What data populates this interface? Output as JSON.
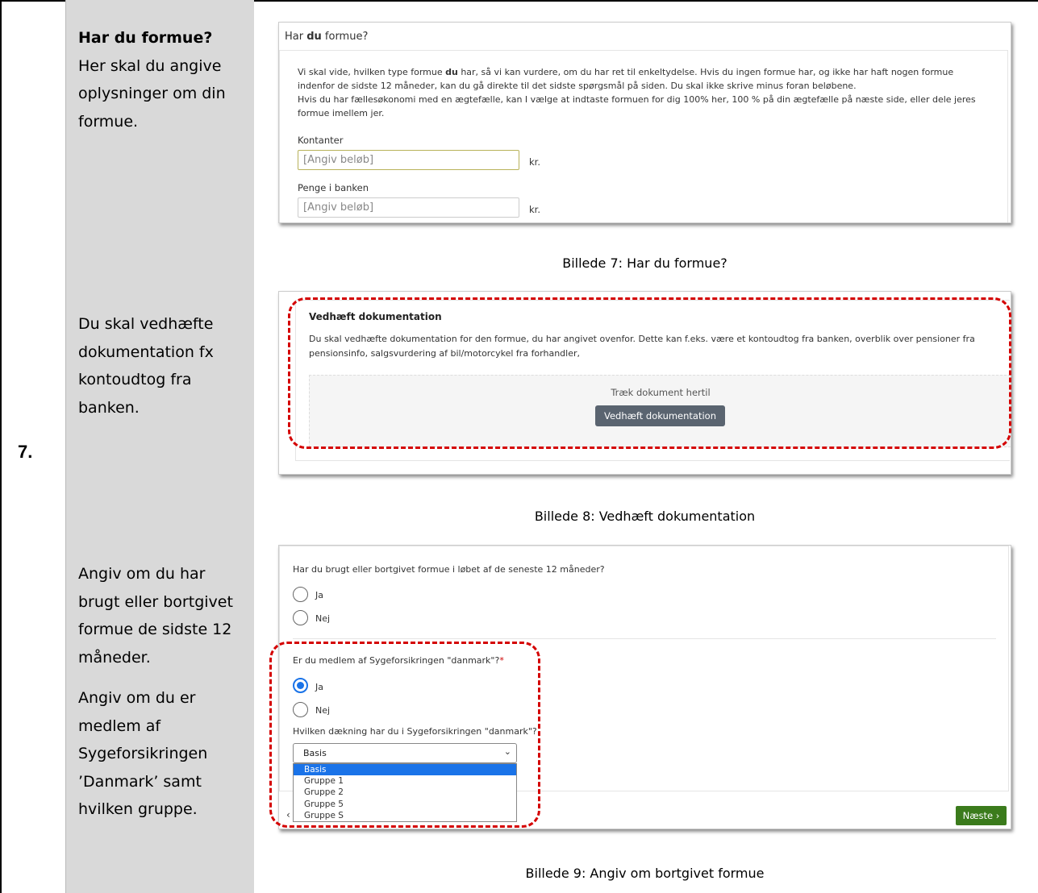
{
  "step": {
    "number": "7."
  },
  "instructions": {
    "one_title": "Har du formue?",
    "one_body": "Her skal du angive oplysninger om din formue.",
    "two_body": "Du skal vedhæfte dokumentation fx kontoudtog fra banken.",
    "three_body_a": "Angiv om du har brugt eller bortgivet formue de sidste 12 måneder.",
    "three_body_b": "Angiv om du er medlem af Sygeforsikringen ’Danmark’ samt hvilken gruppe."
  },
  "shot1": {
    "title_pre": "Har ",
    "title_bold": "du",
    "title_post": " formue?",
    "desc_a": "Vi skal vide, hvilken type formue ",
    "desc_bold": "du",
    "desc_b": " har, så vi kan vurdere, om du har ret til enkeltydelse. Hvis du ingen formue har, og ikke har haft nogen formue indenfor de sidste 12 måneder, kan du gå direkte til det sidste spørgsmål på siden. Du skal ikke skrive minus foran beløbene.",
    "desc_c": "Hvis du har fællesøkonomi med en ægtefælle,  kan I vælge at indtaste formuen for dig 100% her, 100 % på din ægtefælle på næste side, eller dele jeres formue imellem jer.",
    "field1_label": "Kontanter",
    "field1_placeholder": "[Angiv beløb]",
    "field2_label": "Penge i banken",
    "field2_placeholder": "[Angiv beløb]",
    "unit": "kr."
  },
  "caption1": "Billede 7: Har du formue?",
  "shot2": {
    "heading": "Vedhæft dokumentation",
    "desc": "Du skal vedhæfte dokumentation for den formue, du har angivet ovenfor. Dette kan f.eks. være et kontoudtog fra banken, overblik over pensioner fra pensionsinfo, salgsvurdering af bil/motorcykel fra forhandler,",
    "drop_text": "Træk dokument hertil",
    "attach_label": "Vedhæft dokumentation"
  },
  "caption2": "Billede 8: Vedhæft dokumentation",
  "shot3": {
    "q1": "Har du brugt eller bortgivet formue i løbet af de seneste 12 måneder?",
    "yes": "Ja",
    "no": "Nej",
    "q2": "Er du medlem af Sygeforsikringen \"danmark\"?",
    "required_mark": "*",
    "q3": "Hvilken dækning har du i Sygeforsikringen \"danmark\"?",
    "select_value": "Basis",
    "options": [
      "Basis",
      "Gruppe 1",
      "Gruppe 2",
      "Gruppe 5",
      "Gruppe S"
    ],
    "next_label": "Næste ›",
    "prev_stub": "‹"
  },
  "caption3": "Billede 9: Angiv om bortgivet formue",
  "colors": {
    "highlight": "#d40000",
    "next_button": "#3b7b1c",
    "attach_button": "#5a6470",
    "radio_selected": "#1a73e8"
  }
}
